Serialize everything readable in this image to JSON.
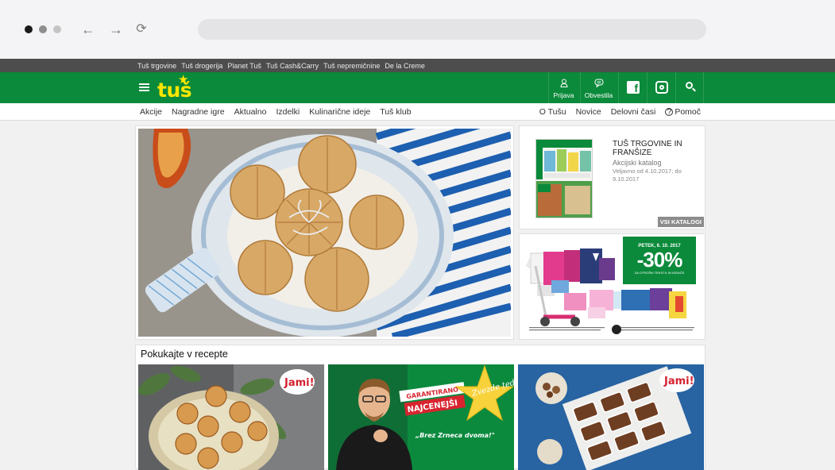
{
  "topbar": {
    "links": [
      "Tuš trgovine",
      "Tuš drogerija",
      "Planet Tuš",
      "Tuš Cash&Carry",
      "Tuš nepremičnine",
      "De la Creme"
    ]
  },
  "header": {
    "logo_text": "tuš",
    "login_label": "Prijava",
    "notifications_label": "Obvestila",
    "brand_color": "#0a8a3a",
    "logo_color": "#ffe600"
  },
  "subnav": {
    "left": [
      "Akcije",
      "Nagradne igre",
      "Aktualno",
      "Izdelki",
      "Kulinarične ideje",
      "Tuš klub"
    ],
    "right": [
      "O Tušu",
      "Novice",
      "Delovni časi"
    ],
    "help_label": "Pomoč"
  },
  "catalog": {
    "title": "Tuš trgovine in franšize",
    "subtitle": "Akcijski katalog",
    "validity": "Veljavno od 4.10.2017; do 9.10.2017",
    "all_catalogs": "VSI KATALOGI"
  },
  "promo": {
    "date": "PETEK, 6. 10. 2017",
    "discount": "-30%",
    "note": "ZA OTROŠKI TEKSTIL IN IGRAČE"
  },
  "recipes": {
    "heading": "Pokukajte v recepte",
    "badge1": "Jami!",
    "banner_line1": "GARANTIRANO",
    "banner_line2": "NAJCENEJŠI",
    "star_text": "Zvezde tedna",
    "quote": "„Brez Zrneca dvoma!\"",
    "badge3": "Jami!"
  }
}
